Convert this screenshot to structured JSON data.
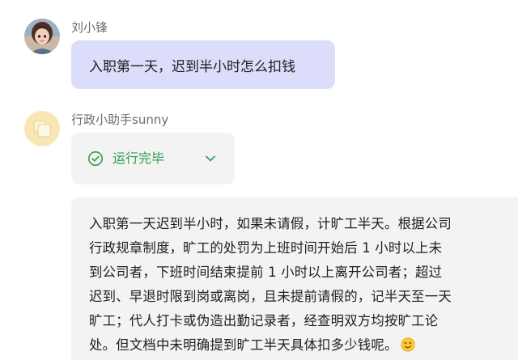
{
  "user": {
    "name": "刘小锋",
    "message": "入职第一天，迟到半小时怎么扣钱"
  },
  "assistant": {
    "name": "行政小助手sunny",
    "status": "运行完毕",
    "answer_lines": [
      "入职第一天迟到半小时，如果未请假，计旷工半天。根据公司",
      "行政规章制度，旷工的处罚为上班时间开始后 1 小时以上未",
      "到公司者，下班时间结束提前 1 小时以上离开公司者；超过",
      "迟到、早退时限到岗或离岗，且未提前请假的，记半天至一天",
      "旷工；代人打卡或伪造出勤记录者，经查明双方均按旷工论",
      "处。但文档中未明确提到旷工半天具体扣多少钱呢。"
    ]
  },
  "icons": {
    "user_avatar": "user-avatar-portrait",
    "bot_avatar": "bot-avatar-squares",
    "status_icon": "check-circle-icon",
    "expand_icon": "chevron-down-icon",
    "emoji": "wink-emoji-icon"
  },
  "colors": {
    "user_bubble": "#dcdcfb",
    "assistant_bubble": "#f3f3f3",
    "status_green": "#2f9e4f",
    "bot_avatar_bg": "#f6e7b5"
  }
}
